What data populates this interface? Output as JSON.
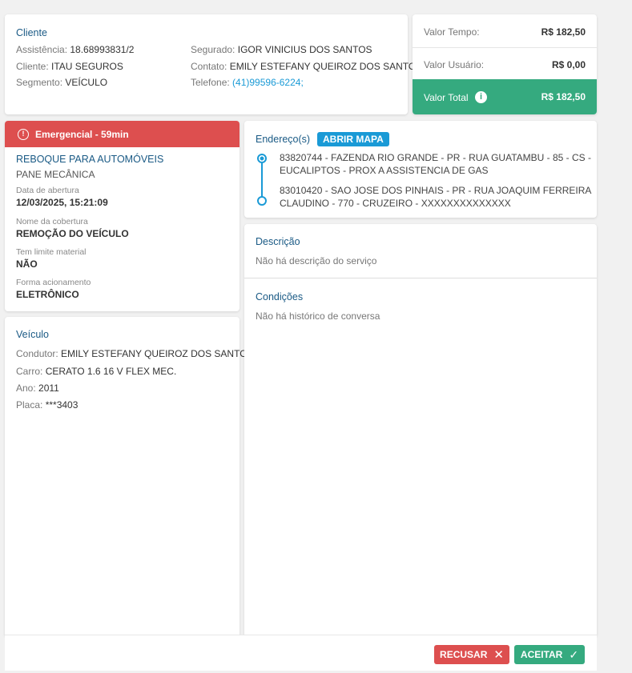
{
  "cliente": {
    "title": "Cliente",
    "left": [
      {
        "label": "Assistência:",
        "value": "18.68993831/2"
      },
      {
        "label": "Cliente:",
        "value": "ITAU SEGUROS"
      },
      {
        "label": "Segmento:",
        "value": "VEÍCULO"
      }
    ],
    "right": [
      {
        "label": "Segurado:",
        "value": "IGOR VINICIUS DOS SANTOS"
      },
      {
        "label": "Contato:",
        "value": "EMILY ESTEFANY QUEIROZ DOS SANTOS"
      },
      {
        "label": "Telefone:",
        "value": "(41)99596-6224;"
      }
    ]
  },
  "valores": {
    "tempo_label": "Valor Tempo:",
    "tempo": "R$ 182,50",
    "usuario_label": "Valor Usuário:",
    "usuario": "R$ 0,00",
    "total_label": "Valor Total",
    "total": "R$ 182,50",
    "total_color": "#35aa7f"
  },
  "servico": {
    "badge": "Emergencial - 59min",
    "badge_color": "#dd4f4f",
    "tipo": "REBOQUE PARA AUTOMÓVEIS",
    "motivo": "PANE MECÂNICA",
    "fields": [
      {
        "label": "Data de abertura",
        "value": "12/03/2025, 15:21:09"
      },
      {
        "label": "Nome da cobertura",
        "value": "REMOÇÃO DO VEÍCULO"
      },
      {
        "label": "Tem limite material",
        "value": "NÃO"
      },
      {
        "label": "Forma acionamento",
        "value": "ELETRÔNICO"
      }
    ]
  },
  "veiculo": {
    "title": "Veículo",
    "rows": [
      {
        "label": "Condutor:",
        "value": "EMILY ESTEFANY QUEIROZ DOS SANTOS"
      },
      {
        "label": "Carro:",
        "value": "CERATO 1.6 16 V FLEX MEC."
      },
      {
        "label": "Ano:",
        "value": "2011"
      },
      {
        "label": "Placa:",
        "value": "***3403"
      }
    ]
  },
  "enderecos": {
    "title": "Endereço(s)",
    "map_button": "ABRIR MAPA",
    "origem": [
      "83820744 - FAZENDA RIO GRANDE - PR - RUA GUATAMBU - 85 - CS -",
      "EUCALIPTOS - PROX A ASSISTENCIA DE GAS"
    ],
    "destino": [
      "83010420 - SAO JOSE DOS PINHAIS - PR - RUA JOAQUIM FERREIRA",
      "CLAUDINO - 770 - CRUZEIRO - XXXXXXXXXXXXXX"
    ]
  },
  "descricao": {
    "title": "Descrição",
    "text": "Não há descrição do serviço"
  },
  "condicoes": {
    "title": "Condições",
    "text": "Não há histórico de conversa"
  },
  "footer": {
    "recusar": "RECUSAR",
    "aceitar": "ACEITAR"
  }
}
